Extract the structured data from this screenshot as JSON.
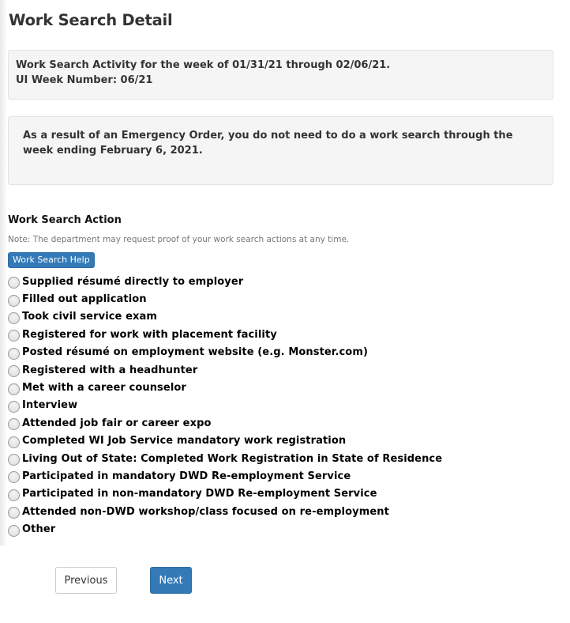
{
  "page": {
    "title": "Work Search Detail"
  },
  "week_info": {
    "activity_line": "Work Search Activity for the week of 01/31/21 through 02/06/21.",
    "week_number_line": "UI Week Number: 06/21"
  },
  "notice": {
    "text": "As a result of an Emergency Order, you do not need to do a work search through the week ending February 6, 2021."
  },
  "work_search_action": {
    "title": "Work Search Action",
    "note": "Note: The department may request proof of your work search actions at any time.",
    "help_button_label": "Work Search Help",
    "options": [
      {
        "label": "Supplied résumé directly to employer",
        "selected": false
      },
      {
        "label": "Filled out application",
        "selected": false
      },
      {
        "label": "Took civil service exam",
        "selected": false
      },
      {
        "label": "Registered for work with placement facility",
        "selected": false
      },
      {
        "label": "Posted résumé on employment website (e.g. Monster.com)",
        "selected": false
      },
      {
        "label": "Registered with a headhunter",
        "selected": false
      },
      {
        "label": "Met with a career counselor",
        "selected": false
      },
      {
        "label": "Interview",
        "selected": false
      },
      {
        "label": "Attended job fair or career expo",
        "selected": false
      },
      {
        "label": "Completed WI Job Service mandatory work registration",
        "selected": false
      },
      {
        "label": "Living Out of State: Completed Work Registration in State of Residence",
        "selected": false
      },
      {
        "label": "Participated in mandatory DWD Re-employment Service",
        "selected": false
      },
      {
        "label": "Participated in non-mandatory DWD Re-employment Service",
        "selected": false
      },
      {
        "label": "Attended non-DWD workshop/class focused on re-employment",
        "selected": false
      },
      {
        "label": "Other",
        "selected": false
      }
    ]
  },
  "navigation": {
    "previous_label": "Previous",
    "next_label": "Next"
  },
  "colors": {
    "primary": "#337ab7",
    "well_background": "#f5f5f5",
    "text": "#333333",
    "note_text": "#777777"
  }
}
